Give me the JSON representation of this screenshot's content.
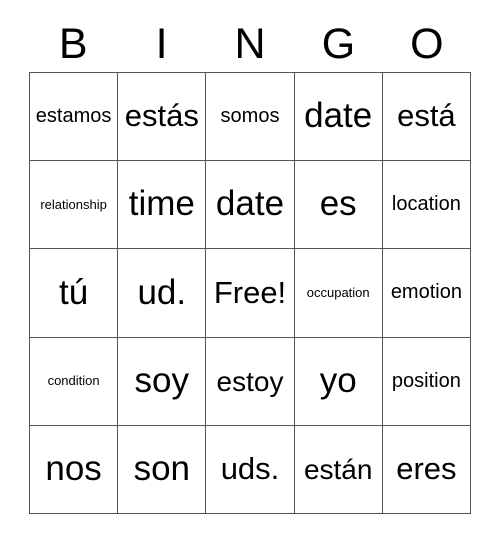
{
  "card": {
    "header_letters": [
      "B",
      "I",
      "N",
      "G",
      "O"
    ],
    "free_space_label": "Free!",
    "grid_line_color": "#545454",
    "text_color": "#000000",
    "background_color": "#ffffff",
    "rows": [
      [
        {
          "text": "estamos",
          "size": "s-sm"
        },
        {
          "text": "estás",
          "size": "s-xl"
        },
        {
          "text": "somos",
          "size": "s-sm"
        },
        {
          "text": "date",
          "size": "s-xxl"
        },
        {
          "text": "está",
          "size": "s-xl"
        }
      ],
      [
        {
          "text": "relationship",
          "size": "s-xs"
        },
        {
          "text": "time",
          "size": "s-xxl"
        },
        {
          "text": "date",
          "size": "s-xxl"
        },
        {
          "text": "es",
          "size": "s-xxl"
        },
        {
          "text": "location",
          "size": "s-sm"
        }
      ],
      [
        {
          "text": "tú",
          "size": "s-xxl"
        },
        {
          "text": "ud.",
          "size": "s-xxl"
        },
        {
          "text": "Free!",
          "size": "s-xl"
        },
        {
          "text": "occupation",
          "size": "s-xs"
        },
        {
          "text": "emotion",
          "size": "s-sm"
        }
      ],
      [
        {
          "text": "condition",
          "size": "s-xs"
        },
        {
          "text": "soy",
          "size": "s-xxl"
        },
        {
          "text": "estoy",
          "size": "s-lg"
        },
        {
          "text": "yo",
          "size": "s-xxl"
        },
        {
          "text": "position",
          "size": "s-sm"
        }
      ],
      [
        {
          "text": "nos",
          "size": "s-xxl"
        },
        {
          "text": "son",
          "size": "s-xxl"
        },
        {
          "text": "uds.",
          "size": "s-xl"
        },
        {
          "text": "están",
          "size": "s-lg"
        },
        {
          "text": "eres",
          "size": "s-xl"
        }
      ]
    ]
  }
}
